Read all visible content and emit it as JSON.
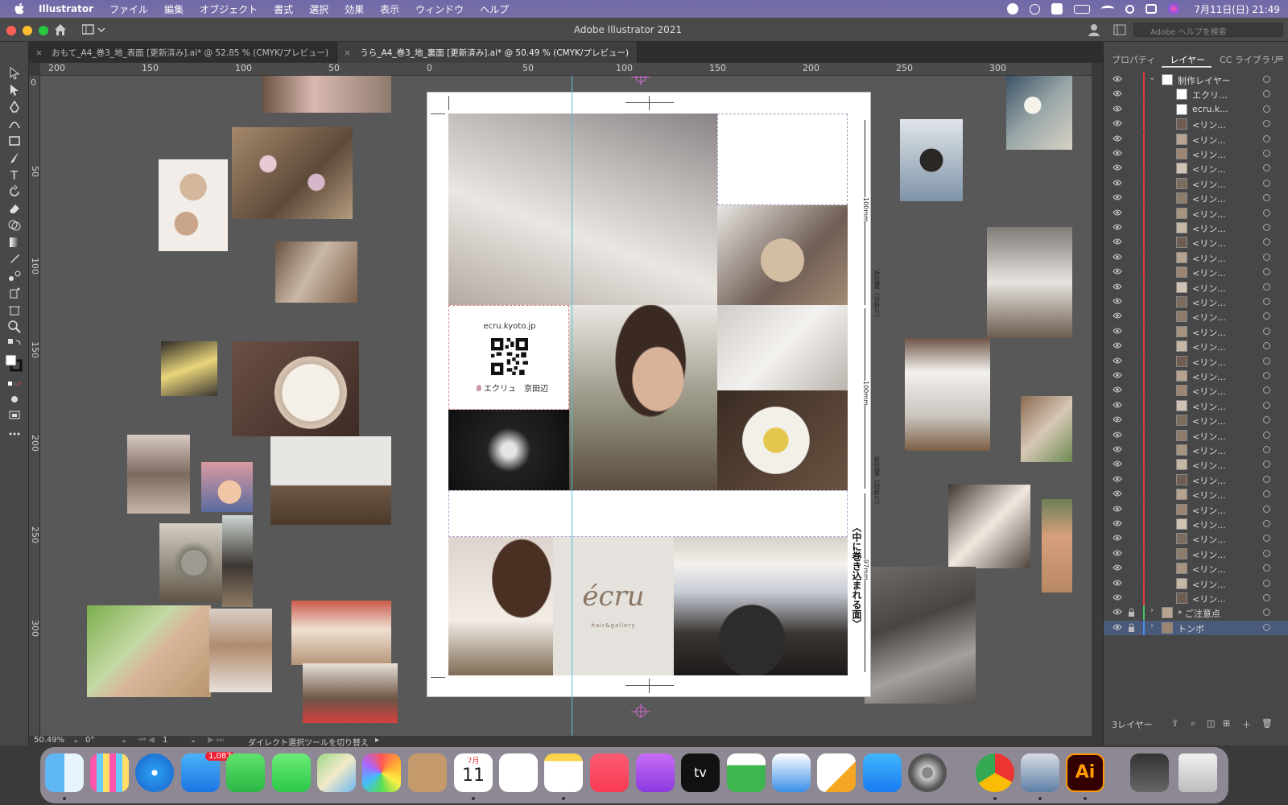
{
  "menubar": {
    "app_name": "Illustrator",
    "items": [
      "ファイル",
      "編集",
      "オブジェクト",
      "書式",
      "選択",
      "効果",
      "表示",
      "ウィンドウ",
      "ヘルプ"
    ],
    "clock": "7月11日(日)  21:49"
  },
  "window": {
    "title": "Adobe Illustrator 2021",
    "search_placeholder": "Adobe ヘルプを検索"
  },
  "tabs": [
    {
      "label": "おもて_A4_巻3_地_表面 [更新済み].ai* @ 52.85 % (CMYK/プレビュー)",
      "active": false
    },
    {
      "label": "うら_A4_巻3_地_裏面 [更新済み].ai* @ 50.49 % (CMYK/プレビュー)",
      "active": true
    }
  ],
  "rulers": {
    "h_labels": [
      "200",
      "150",
      "100",
      "50",
      "0",
      "50",
      "100",
      "150",
      "200",
      "250",
      "300"
    ],
    "v_labels": [
      "0",
      "50",
      "100",
      "150",
      "200",
      "250",
      "300"
    ]
  },
  "artboard": {
    "url_text": "ecru.kyoto.jp",
    "shop_text": "エクリュ　京田辺",
    "logo_text": "écru",
    "logo_sub": "hair&gallery",
    "dim1": "100mm",
    "fold1": "折位置（谷折り）",
    "dim2": "100mm",
    "fold2": "折位置（谷折り）",
    "dim3": "97mm",
    "inner_label": "〈中に巻き込まれる面〉"
  },
  "statusbar": {
    "zoom": "50.49%",
    "angle": "0°",
    "page": "1",
    "tool_hint": "ダイレクト選択ツールを切り替え"
  },
  "panel": {
    "tabs": [
      "プロパティ",
      "レイヤー",
      "CC ライブラリ"
    ],
    "active_tab": "レイヤー",
    "layers": [
      {
        "name": "制作レイヤー",
        "level": 0,
        "expanded": true
      },
      {
        "name": "エクリ...",
        "level": 1
      },
      {
        "name": "ecru.k...",
        "level": 1
      },
      {
        "name": "<リン...",
        "level": 1
      },
      {
        "name": "<リン...",
        "level": 1
      },
      {
        "name": "<リン...",
        "level": 1
      },
      {
        "name": "<リン...",
        "level": 1
      },
      {
        "name": "<リン...",
        "level": 1
      },
      {
        "name": "<リン...",
        "level": 1
      },
      {
        "name": "<リン...",
        "level": 1
      },
      {
        "name": "<リン...",
        "level": 1
      },
      {
        "name": "<リン...",
        "level": 1
      },
      {
        "name": "<リン...",
        "level": 1
      },
      {
        "name": "<リン...",
        "level": 1
      },
      {
        "name": "<リン...",
        "level": 1
      },
      {
        "name": "<リン...",
        "level": 1
      },
      {
        "name": "<リン...",
        "level": 1
      },
      {
        "name": "<リン...",
        "level": 1
      },
      {
        "name": "<リン...",
        "level": 1
      },
      {
        "name": "<リン...",
        "level": 1
      },
      {
        "name": "<リン...",
        "level": 1
      },
      {
        "name": "<リン...",
        "level": 1
      },
      {
        "name": "<リン...",
        "level": 1
      },
      {
        "name": "<リン...",
        "level": 1
      },
      {
        "name": "<リン...",
        "level": 1
      },
      {
        "name": "<リン...",
        "level": 1
      },
      {
        "name": "<リン...",
        "level": 1
      },
      {
        "name": "<リン...",
        "level": 1
      },
      {
        "name": "<リン...",
        "level": 1
      },
      {
        "name": "<リン...",
        "level": 1
      },
      {
        "name": "<リン...",
        "level": 1
      },
      {
        "name": "<リン...",
        "level": 1
      },
      {
        "name": "<リン...",
        "level": 1
      },
      {
        "name": "<リン...",
        "level": 1
      },
      {
        "name": "<リン...",
        "level": 1
      },
      {
        "name": "<リン...",
        "level": 1
      },
      {
        "name": "* ご注意点",
        "level": 0,
        "locked": true
      },
      {
        "name": "トンボ",
        "level": 0,
        "locked": true,
        "selected": true
      }
    ],
    "footer_label": "3レイヤー"
  },
  "dock": {
    "mail_badge": "1,087",
    "calendar_month": "7月",
    "calendar_day": "11",
    "tv_label": "tv",
    "ai_label": "Ai"
  }
}
